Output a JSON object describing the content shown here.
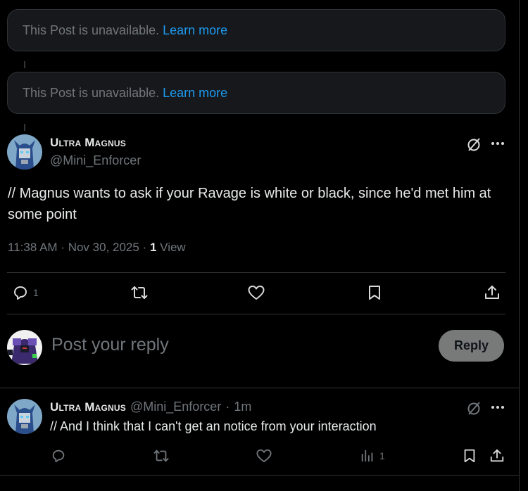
{
  "unavailable_posts": [
    {
      "text": "This Post is unavailable.",
      "link": "Learn more"
    },
    {
      "text": "This Post is unavailable.",
      "link": "Learn more"
    }
  ],
  "main_post": {
    "display_name": "Ultra Magnus",
    "handle": "@Mini_Enforcer",
    "text": "// Magnus wants to ask if your Ravage is white or black, since he'd met him at some point",
    "time": "11:38 AM",
    "date": "Nov 30, 2025",
    "views_count": "1",
    "views_label": "View",
    "reply_count": "1"
  },
  "composer": {
    "placeholder": "Post your reply",
    "button": "Reply"
  },
  "reply_post": {
    "display_name": "Ultra Magnus",
    "handle": "@Mini_Enforcer",
    "age": "1m",
    "text": "// And I think that I can't get an notice from your interaction",
    "views_count": "1"
  },
  "icons": {
    "grok": "grok-slash-circle-icon",
    "more": "more-dots-icon",
    "reply": "comment-icon",
    "repost": "repost-icon",
    "like": "heart-icon",
    "bookmark": "bookmark-icon",
    "share": "share-upload-icon",
    "views": "bar-chart-icon"
  },
  "colors": {
    "background": "#000000",
    "link": "#1d9bf0",
    "muted": "#71767b",
    "text": "#e7e9ea",
    "border": "#2f3336"
  }
}
